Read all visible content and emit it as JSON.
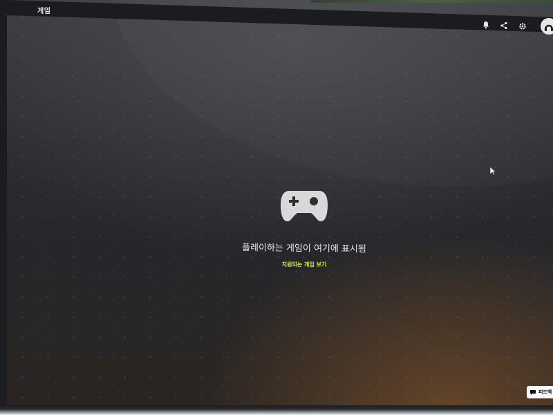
{
  "header": {
    "title": "게임"
  },
  "toolbar": {
    "icons": [
      "bell-icon",
      "share-icon",
      "settings-icon",
      "avatar"
    ]
  },
  "empty_state": {
    "icon": "gamepad-icon",
    "message": "플레이하는 게임이 여기에 표시됨",
    "link_label": "지원되는 게임 보기"
  },
  "feedback": {
    "label": "피드백",
    "icon": "chat-icon"
  },
  "colors": {
    "accent": "#c8ec3a",
    "background": "#2c2e32",
    "text": "#e9e9e9"
  }
}
